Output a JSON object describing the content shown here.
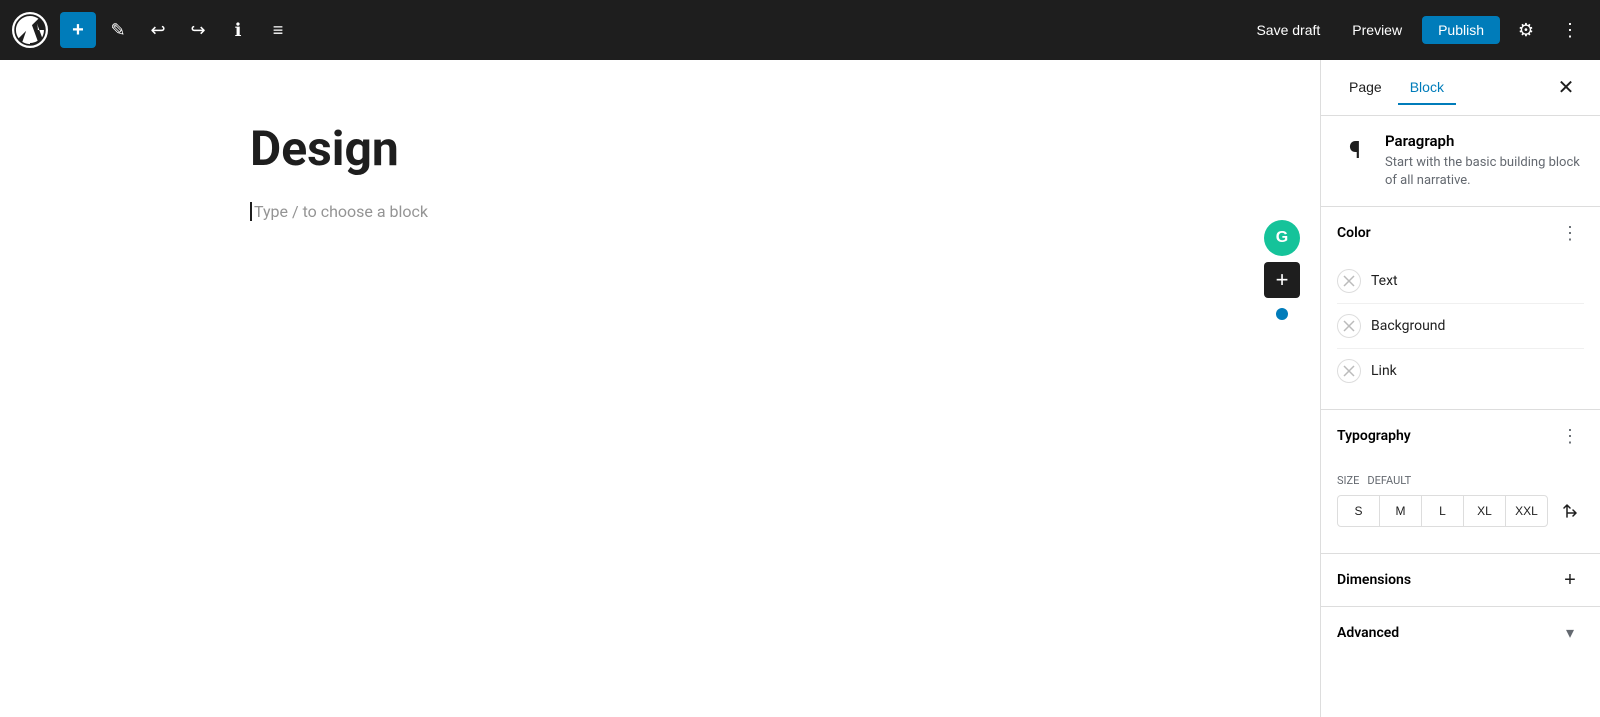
{
  "toolbar": {
    "add_label": "+",
    "save_draft_label": "Save draft",
    "preview_label": "Preview",
    "publish_label": "Publish",
    "undo_icon": "↩",
    "redo_icon": "↪",
    "info_icon": "ℹ",
    "list_icon": "≡",
    "settings_icon": "⚙",
    "more_icon": "⋮",
    "edit_icon": "✎"
  },
  "editor": {
    "page_title": "Design",
    "placeholder_text": "Type / to choose a block"
  },
  "sidebar": {
    "tab_page": "Page",
    "tab_block": "Block",
    "close_icon": "✕",
    "block_info": {
      "title": "Paragraph",
      "description": "Start with the basic building block of all narrative.",
      "icon": "¶"
    },
    "color_section": {
      "title": "Color",
      "more_icon": "⋮",
      "options": [
        {
          "label": "Text"
        },
        {
          "label": "Background"
        },
        {
          "label": "Link"
        }
      ]
    },
    "typography_section": {
      "title": "Typography",
      "more_icon": "⋮",
      "size_label": "SIZE",
      "size_default": "DEFAULT",
      "sizes": [
        "S",
        "M",
        "L",
        "XL",
        "XXL"
      ],
      "adjust_icon": "⇄"
    },
    "dimensions_section": {
      "title": "Dimensions",
      "add_icon": "+"
    },
    "advanced_section": {
      "title": "Advanced",
      "chevron_icon": "▾"
    }
  }
}
